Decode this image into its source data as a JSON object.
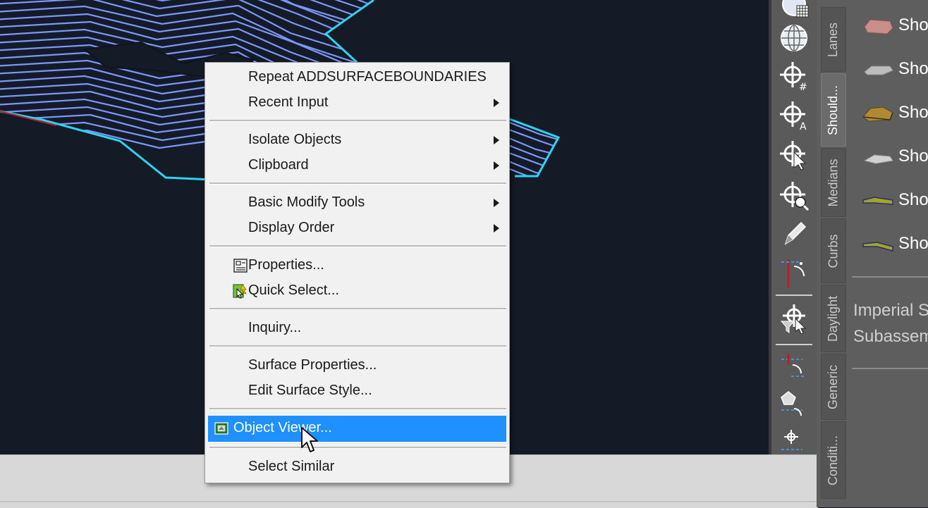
{
  "context_menu": {
    "items": [
      {
        "label": "Repeat ADDSURFACEBOUNDARIES",
        "submenu": false
      },
      {
        "label": "Recent Input",
        "submenu": true
      },
      {
        "label": "Isolate Objects",
        "submenu": true
      },
      {
        "label": "Clipboard",
        "submenu": true
      },
      {
        "label": "Basic Modify Tools",
        "submenu": true
      },
      {
        "label": "Display Order",
        "submenu": true
      },
      {
        "label": "Properties...",
        "icon": "properties-icon"
      },
      {
        "label": "Quick Select...",
        "icon": "quick-select-icon"
      },
      {
        "label": "Inquiry..."
      },
      {
        "label": "Surface Properties..."
      },
      {
        "label": "Edit Surface Style..."
      },
      {
        "label": "Object Viewer...",
        "icon": "object-viewer-icon",
        "highlighted": true
      },
      {
        "label": "Select Similar"
      }
    ]
  },
  "palette": {
    "tabs": [
      "Lanes",
      "Should...",
      "Medians",
      "Curbs",
      "Daylight",
      "Generic",
      "Conditi..."
    ],
    "active_tab": "Should...",
    "items": [
      "Sho",
      "Sho",
      "Sho",
      "Sho",
      "Sho",
      "Sho"
    ],
    "footer_line1": "Imperial S",
    "footer_line2": "Subassem"
  },
  "toolbar": {
    "icons": [
      "grid-tool-icon",
      "globe-tool-icon",
      "crosshair-hash-icon",
      "crosshair-a-icon",
      "crosshair-select-icon",
      "crosshair-zoom-icon",
      "pencil-icon",
      "offset-arc-icon",
      "filter-select-icon",
      "offset-line-icon",
      "insert-point-icon",
      "snap-point-icon"
    ]
  },
  "colors": {
    "menu_highlight": "#1e90ff",
    "contour": "#6f8fff",
    "boundary": "#2fd3f0",
    "viewport_bg": "#141b26"
  }
}
